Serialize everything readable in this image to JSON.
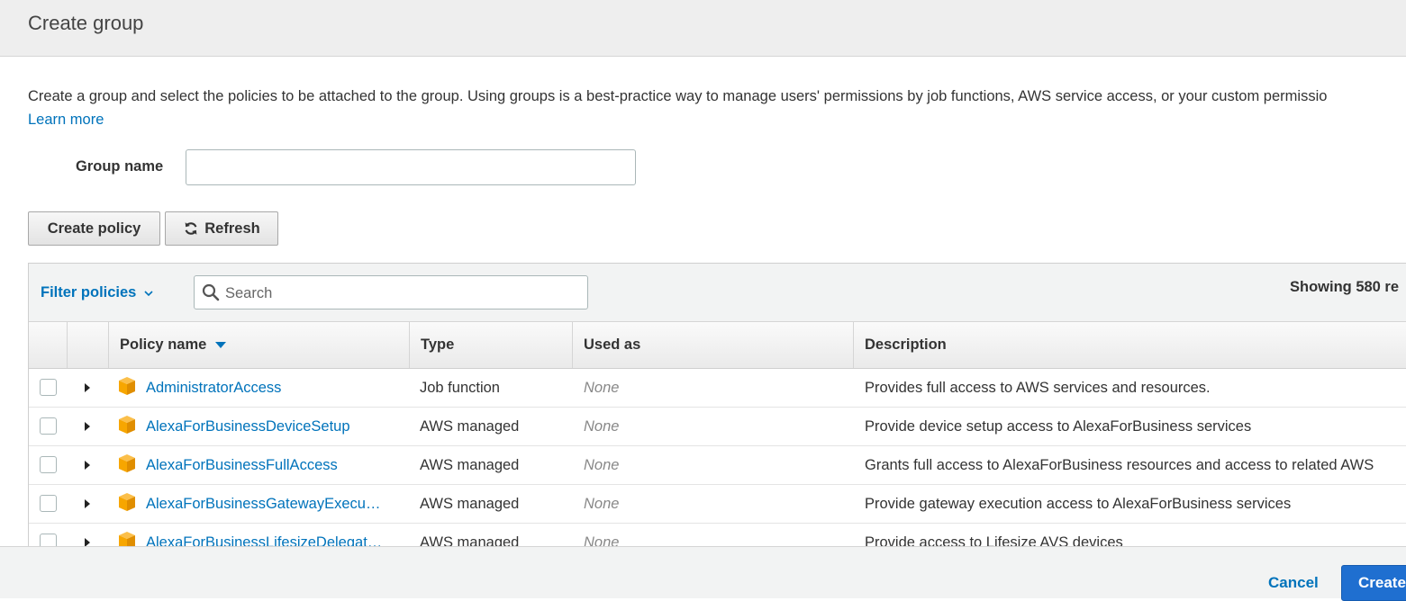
{
  "header": {
    "title": "Create group"
  },
  "intro": {
    "text": "Create a group and select the policies to be attached to the group. Using groups is a best-practice way to manage users' permissions by job functions, AWS service access, or your custom permissio",
    "learn_more": "Learn more"
  },
  "group_name": {
    "label": "Group name",
    "value": ""
  },
  "toolbar_buttons": {
    "create_policy": "Create policy",
    "refresh": "Refresh"
  },
  "filter": {
    "label": "Filter policies",
    "search_placeholder": "Search",
    "showing": "Showing 580 re"
  },
  "table": {
    "columns": [
      "Policy name",
      "Type",
      "Used as",
      "Description"
    ],
    "sorted_by": "Policy name",
    "rows": [
      {
        "name": "AdministratorAccess",
        "type": "Job function",
        "used_as": "None",
        "description": "Provides full access to AWS services and resources."
      },
      {
        "name": "AlexaForBusinessDeviceSetup",
        "type": "AWS managed",
        "used_as": "None",
        "description": "Provide device setup access to AlexaForBusiness services"
      },
      {
        "name": "AlexaForBusinessFullAccess",
        "type": "AWS managed",
        "used_as": "None",
        "description": "Grants full access to AlexaForBusiness resources and access to related AWS"
      },
      {
        "name": "AlexaForBusinessGatewayExecu…",
        "type": "AWS managed",
        "used_as": "None",
        "description": "Provide gateway execution access to AlexaForBusiness services"
      },
      {
        "name": "AlexaForBusinessLifesizeDelegat…",
        "type": "AWS managed",
        "used_as": "None",
        "description": "Provide access to Lifesize AVS devices"
      }
    ]
  },
  "footer": {
    "cancel": "Cancel",
    "create": "Create"
  },
  "colors": {
    "link": "#0073bb",
    "primary_button": "#1f6fd0",
    "policy_icon": "#f7a600"
  }
}
